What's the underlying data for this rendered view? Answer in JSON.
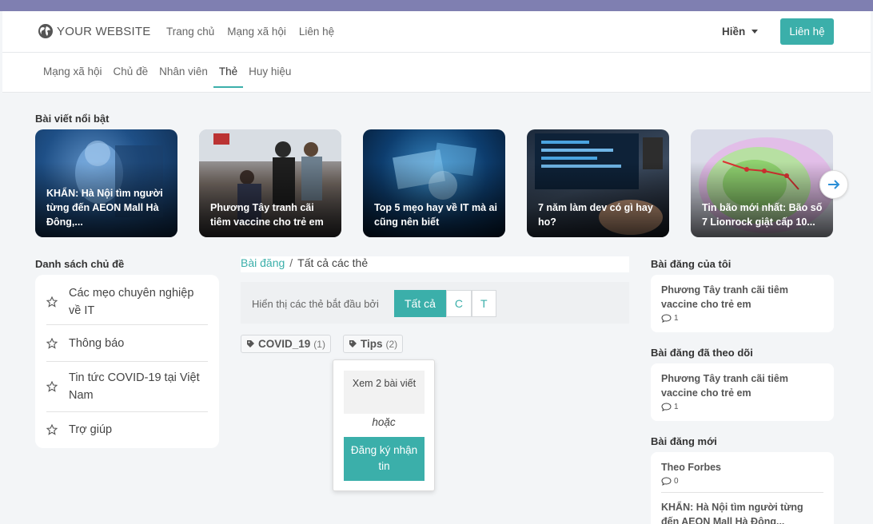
{
  "brand": {
    "logo_text": "YOUR WEBSITE",
    "accent": "#3bafaa"
  },
  "topnav": {
    "items": [
      "Trang chủ",
      "Mạng xã hội",
      "Liên hệ"
    ],
    "user_name": "Hiền",
    "contact_button": "Liên hệ"
  },
  "subnav": {
    "tabs": [
      "Mạng xã hội",
      "Chủ đề",
      "Nhân viên",
      "Thẻ",
      "Huy hiệu"
    ],
    "active_tab": "Thẻ"
  },
  "featured": {
    "title": "Bài viết nổi bật",
    "cards": [
      {
        "caption": "KHẨN: Hà Nội tìm người từng đến AEON Mall Hà Đông,..."
      },
      {
        "caption": "Phương Tây tranh cãi tiêm vaccine cho trẻ em"
      },
      {
        "caption": "Top 5 mẹo hay về IT mà ai cũng nên biết"
      },
      {
        "caption": "7 năm làm dev có gì hay ho?"
      },
      {
        "caption": "Tin bão mới nhất: Bão số 7 Lionrock giật cấp 10..."
      }
    ]
  },
  "topics": {
    "title": "Danh sách chủ đề",
    "items": [
      "Các mẹo chuyên nghiệp về IT",
      "Thông báo",
      "Tin tức COVID-19 tại Việt Nam",
      "Trợ giúp"
    ]
  },
  "breadcrumb": {
    "root": "Bài đăng",
    "separator": "/",
    "current": "Tất cả các thẻ"
  },
  "filter": {
    "label": "Hiển thị các thẻ bắt đầu bởi",
    "options": [
      "Tất cả",
      "C",
      "T"
    ],
    "selected": "Tất cả"
  },
  "tags": [
    {
      "name": "COVID_19",
      "count": "(1)"
    },
    {
      "name": "Tips",
      "count": "(2)"
    }
  ],
  "popover": {
    "view_label": "Xem 2 bài viết",
    "or_label": "hoặc",
    "subscribe_label": "Đăng ký nhận tin"
  },
  "my_posts": {
    "title": "Bài đăng của tôi",
    "items": [
      {
        "title": "Phương Tây tranh cãi tiêm vaccine cho trẻ em",
        "comments": "1"
      }
    ]
  },
  "followed_posts": {
    "title": "Bài đăng đã theo dõi",
    "items": [
      {
        "title": "Phương Tây tranh cãi tiêm vaccine cho trẻ em",
        "comments": "1"
      }
    ]
  },
  "new_posts": {
    "title": "Bài đăng mới",
    "items": [
      {
        "title": "Theo Forbes",
        "comments": "0"
      },
      {
        "title": "KHẨN: Hà Nội tìm người từng đến AEON Mall Hà Đông..."
      }
    ]
  }
}
